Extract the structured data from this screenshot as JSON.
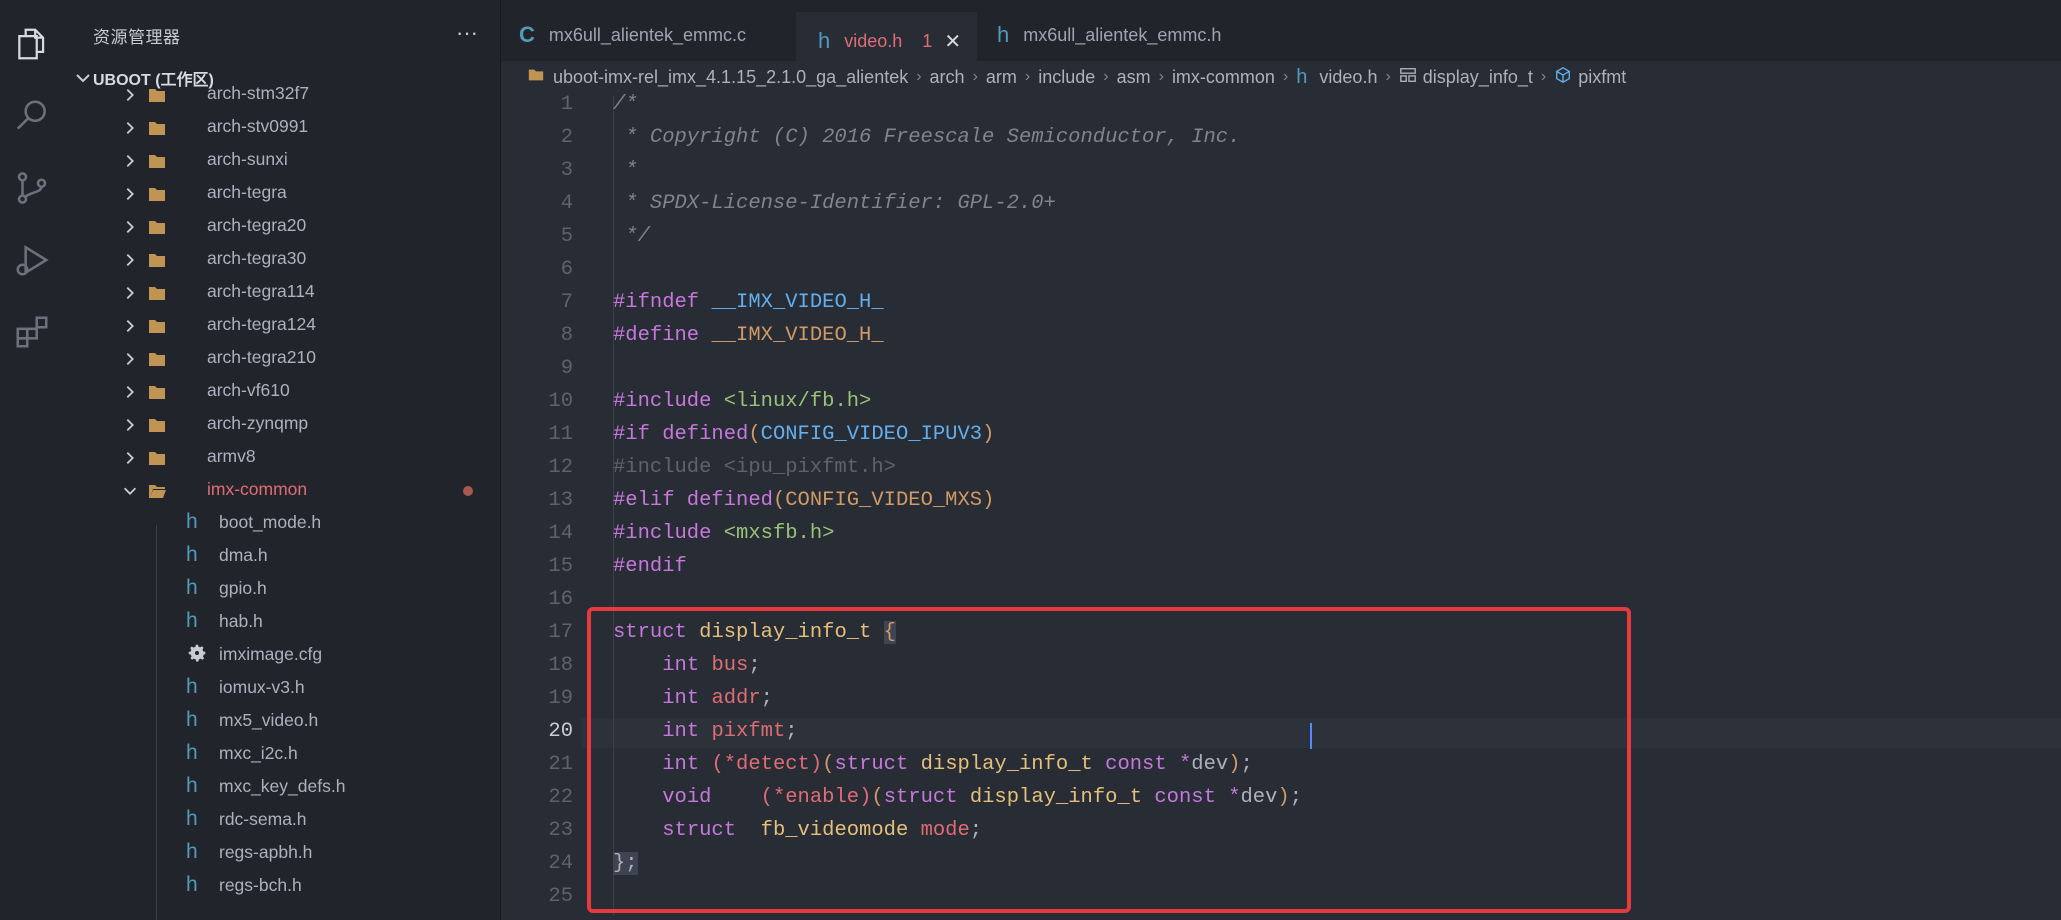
{
  "sidebar": {
    "title": "资源管理器",
    "more": "···",
    "workspace": "UBOOT (工作区)",
    "folders": [
      {
        "label": "arch-stm32f7"
      },
      {
        "label": "arch-stv0991"
      },
      {
        "label": "arch-sunxi"
      },
      {
        "label": "arch-tegra"
      },
      {
        "label": "arch-tegra20"
      },
      {
        "label": "arch-tegra30"
      },
      {
        "label": "arch-tegra114"
      },
      {
        "label": "arch-tegra124"
      },
      {
        "label": "arch-tegra210"
      },
      {
        "label": "arch-vf610"
      },
      {
        "label": "arch-zynqmp"
      },
      {
        "label": "armv8"
      }
    ],
    "open_folder": {
      "label": "imx-common"
    },
    "files": [
      {
        "label": "boot_mode.h",
        "icon": "h-file-icon"
      },
      {
        "label": "dma.h",
        "icon": "h-file-icon"
      },
      {
        "label": "gpio.h",
        "icon": "h-file-icon"
      },
      {
        "label": "hab.h",
        "icon": "h-file-icon"
      },
      {
        "label": "imximage.cfg",
        "icon": "gear-icon"
      },
      {
        "label": "iomux-v3.h",
        "icon": "h-file-icon"
      },
      {
        "label": "mx5_video.h",
        "icon": "h-file-icon"
      },
      {
        "label": "mxc_i2c.h",
        "icon": "h-file-icon"
      },
      {
        "label": "mxc_key_defs.h",
        "icon": "h-file-icon"
      },
      {
        "label": "rdc-sema.h",
        "icon": "h-file-icon"
      },
      {
        "label": "regs-apbh.h",
        "icon": "h-file-icon"
      },
      {
        "label": "regs-bch.h",
        "icon": "h-file-icon"
      }
    ]
  },
  "tabs": [
    {
      "label": "mx6ull_alientek_emmc.c",
      "icon": "C"
    },
    {
      "label": "video.h",
      "icon": "h",
      "problems": "1",
      "close": "✕"
    },
    {
      "label": "mx6ull_alientek_emmc.h",
      "icon": "h"
    }
  ],
  "breadcrumb": {
    "root": "uboot-imx-rel_imx_4.1.15_2.1.0_ga_alientek",
    "arch": "arch",
    "arm": "arm",
    "include": "include",
    "asm": "asm",
    "imx_common": "imx-common",
    "file": "video.h",
    "struct": "display_info_t",
    "field": "pixfmt"
  },
  "editor": {
    "line_numbers": [
      "1",
      "2",
      "3",
      "4",
      "5",
      "6",
      "7",
      "8",
      "9",
      "10",
      "11",
      "12",
      "13",
      "14",
      "15",
      "16",
      "17",
      "18",
      "19",
      "20",
      "21",
      "22",
      "23",
      "24",
      "25"
    ],
    "current_line": "20",
    "lines": {
      "l1": "/*",
      "l2": " * Copyright (C) 2016 Freescale Semiconductor, Inc.",
      "l3": " *",
      "l4": " * SPDX-License-Identifier: GPL-2.0+",
      "l5": " */",
      "l7_kw": "#ifndef",
      "l7_mac": "__IMX_VIDEO_H_",
      "l8_kw": "#define",
      "l8_mac": "__IMX_VIDEO_H_",
      "l10_kw": "#include",
      "l10_str": "<linux/fb.h>",
      "l11_kw": "#if defined",
      "l11_p1": "(",
      "l11_mac": "CONFIG_VIDEO_IPUV3",
      "l11_p2": ")",
      "l12": "#include <ipu_pixfmt.h>",
      "l13_kw": "#elif defined",
      "l13_p1": "(",
      "l13_mac": "CONFIG_VIDEO_MXS",
      "l13_p2": ")",
      "l14_kw": "#include",
      "l14_str": "<mxsfb.h>",
      "l15_kw": "#endif",
      "l17_kw": "struct",
      "l17_typ": "display_info_t",
      "l17_brace": "{",
      "l18_kw": "int",
      "l18_var": "bus",
      "l19_kw": "int",
      "l19_var": "addr",
      "l20_kw": "int",
      "l20_var": "pixfmt",
      "l21_kw": "int",
      "l21_fn": "(*detect)",
      "l21_rest_kw": "struct",
      "l21_typ": "display_info_t",
      "l21_const": "const",
      "l21_ptr": "*",
      "l21_arg": "dev",
      "l22_kw": "void",
      "l22_fn": "(*enable)",
      "l22_rest_kw": "struct",
      "l22_typ": "display_info_t",
      "l22_const": "const",
      "l22_ptr": "*",
      "l22_arg": "dev",
      "l23_kw": "struct",
      "l23_typ": "fb_videomode",
      "l23_var": "mode",
      "l24": "};"
    }
  },
  "colors": {
    "highlight_box": "#e8393f",
    "modified_dot": "#a8584f",
    "accent_tab": "#e06c75"
  }
}
